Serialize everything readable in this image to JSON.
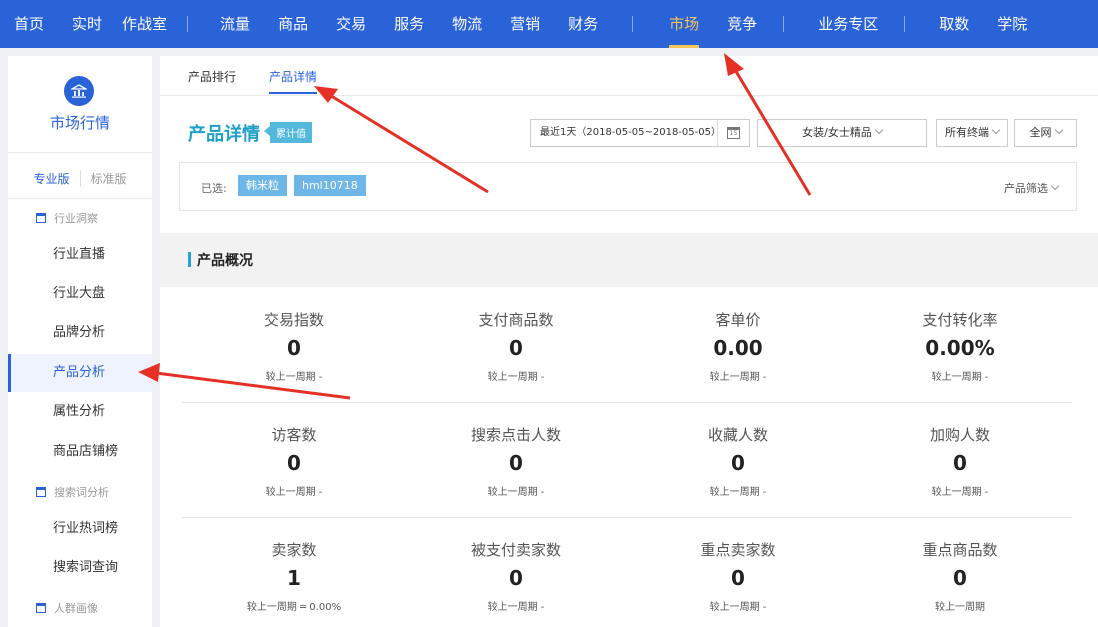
{
  "nav": {
    "items": [
      "首页",
      "实时",
      "作战室",
      "流量",
      "商品",
      "交易",
      "服务",
      "物流",
      "营销",
      "财务",
      "市场",
      "竞争",
      "业务专区",
      "取数",
      "学院"
    ],
    "active": "市场"
  },
  "sidebar": {
    "title": "市场行情",
    "versions": [
      "专业版",
      "标准版"
    ],
    "groups": {
      "industry": "行业洞察",
      "search": "搜索词分析",
      "crowd": "人群画像"
    },
    "items": [
      "行业直播",
      "行业大盘",
      "品牌分析",
      "产品分析",
      "属性分析",
      "商品店铺榜",
      "行业热词榜",
      "搜索词查询"
    ],
    "active": "产品分析"
  },
  "tabs": [
    "产品排行",
    "产品详情"
  ],
  "page": {
    "heading": "产品详情",
    "badge": "累计值",
    "date_range": "最近1天（2018-05-05~2018-05-05）",
    "calendar_day": "15",
    "category": "女装/女士精品",
    "terminal": "所有终端",
    "network": "全网",
    "selected_label": "已选:",
    "chips": [
      "韩米粒",
      "hml10718"
    ],
    "product_filter": "产品筛选"
  },
  "section": {
    "title": "产品概况"
  },
  "metrics": [
    {
      "name": "交易指数",
      "value": "0",
      "compare": "较上一周期  -"
    },
    {
      "name": "支付商品数",
      "value": "0",
      "compare": "较上一周期  -"
    },
    {
      "name": "客单价",
      "value": "0.00",
      "compare": "较上一周期  -"
    },
    {
      "name": "支付转化率",
      "value": "0.00%",
      "compare": "较上一周期  -"
    },
    {
      "name": "访客数",
      "value": "0",
      "compare": "较上一周期  -"
    },
    {
      "name": "搜索点击人数",
      "value": "0",
      "compare": "较上一周期  -"
    },
    {
      "name": "收藏人数",
      "value": "0",
      "compare": "较上一周期  -"
    },
    {
      "name": "加购人数",
      "value": "0",
      "compare": "较上一周期  -"
    },
    {
      "name": "卖家数",
      "value": "1",
      "compare": "较上一周期  ═ 0.00%"
    },
    {
      "name": "被支付卖家数",
      "value": "0",
      "compare": "较上一周期  -"
    },
    {
      "name": "重点卖家数",
      "value": "0",
      "compare": "较上一周期  -"
    },
    {
      "name": "重点商品数",
      "value": "0",
      "compare": "较上一周期"
    }
  ],
  "colors": {
    "brand": "#2a62d8",
    "nav_active": "#f6c55a",
    "heading": "#1ea0c8",
    "arrow": "#e53125"
  }
}
